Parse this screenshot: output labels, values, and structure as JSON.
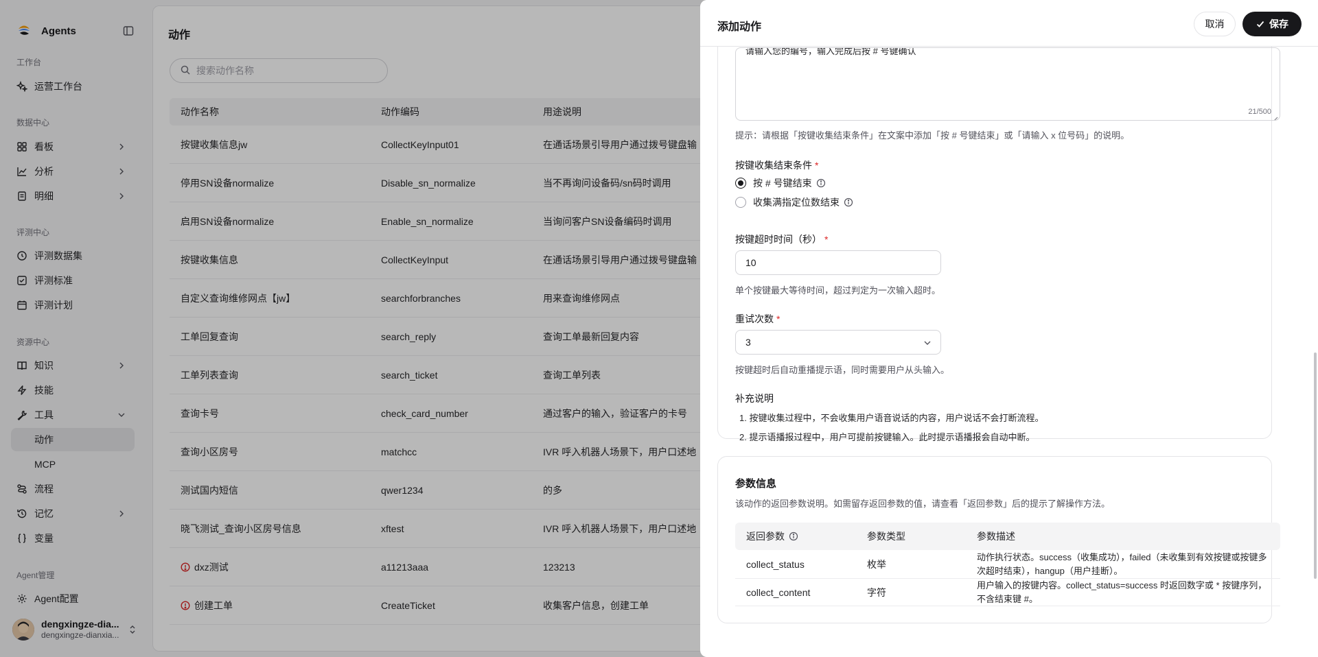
{
  "sidebar": {
    "brand": "Agents",
    "sections": {
      "workbench": "工作台",
      "data_center": "数据中心",
      "eval_center": "评测中心",
      "resource_center": "资源中心",
      "agent_mgmt": "Agent管理"
    },
    "items": {
      "ops_workbench": "运营工作台",
      "dashboard": "看板",
      "analysis": "分析",
      "details": "明细",
      "eval_dataset": "评测数据集",
      "eval_standard": "评测标准",
      "eval_plan": "评测计划",
      "knowledge": "知识",
      "skills": "技能",
      "tools": "工具",
      "actions": "动作",
      "mcp": "MCP",
      "flow": "流程",
      "memory": "记忆",
      "variables": "变量",
      "agent_config": "Agent配置"
    },
    "user": {
      "name": "dengxingze-dia...",
      "email": "dengxingze-dianxia..."
    }
  },
  "main": {
    "title": "动作",
    "search_placeholder": "搜索动作名称",
    "columns": [
      "动作名称",
      "动作编码",
      "用途说明"
    ],
    "rows": [
      {
        "name": "按键收集信息jw",
        "code": "CollectKeyInput01",
        "desc": "在通话场景引导用户通过拨号键盘输",
        "warn": false
      },
      {
        "name": "停用SN设备normalize",
        "code": "Disable_sn_normalize",
        "desc": "当不再询问设备码/sn码时调用",
        "warn": false
      },
      {
        "name": "启用SN设备normalize",
        "code": "Enable_sn_normalize",
        "desc": "当询问客户SN设备编码时调用",
        "warn": false
      },
      {
        "name": "按键收集信息",
        "code": "CollectKeyInput",
        "desc": "在通话场景引导用户通过拨号键盘输",
        "warn": false
      },
      {
        "name": "自定义查询维修网点【jw】",
        "code": "searchforbranches",
        "desc": "用来查询维修网点",
        "warn": false
      },
      {
        "name": "工单回复查询",
        "code": "search_reply",
        "desc": "查询工单最新回复内容",
        "warn": false
      },
      {
        "name": "工单列表查询",
        "code": "search_ticket",
        "desc": "查询工单列表",
        "warn": false
      },
      {
        "name": "查询卡号",
        "code": "check_card_number",
        "desc": "通过客户的输入，验证客户的卡号",
        "warn": false
      },
      {
        "name": "查询小区房号",
        "code": "matchcc",
        "desc": "IVR 呼入机器人场景下，用户口述地",
        "warn": false
      },
      {
        "name": "测试国内短信",
        "code": "qwer1234",
        "desc": "的多",
        "warn": false
      },
      {
        "name": "晓飞测试_查询小区房号信息",
        "code": "xftest",
        "desc": "IVR 呼入机器人场景下，用户口述地",
        "warn": false
      },
      {
        "name": "dxz测试",
        "code": "a11213aaa",
        "desc": "123213",
        "warn": true
      },
      {
        "name": "创建工单",
        "code": "CreateTicket",
        "desc": "收集客户信息，创建工单",
        "warn": true
      }
    ]
  },
  "drawer": {
    "title": "添加动作",
    "cancel": "取消",
    "save": "保存",
    "prompt_text": "请输入您的编号，输入完成后按 # 号键确认",
    "prompt_count": "21/500",
    "prompt_hint": "提示：请根据「按键收集结束条件」在文案中添加「按 # 号键结束」或「请输入 x 位号码」的说明。",
    "end_condition": {
      "label": "按键收集结束条件",
      "options": [
        "按 # 号键结束",
        "收集满指定位数结束"
      ],
      "selected": 0
    },
    "timeout": {
      "label": "按键超时时间（秒）",
      "value": "10",
      "hint": "单个按键最大等待时间，超过判定为一次输入超时。"
    },
    "retry": {
      "label": "重试次数",
      "value": "3",
      "hint": "按键超时后自动重播提示语，同时需要用户从头输入。"
    },
    "notes": {
      "title": "补充说明",
      "items": [
        "1. 按键收集过程中，不会收集用户语音说话的内容，用户说话不会打断流程。",
        "2. 提示语播报过程中，用户可提前按键输入。此时提示语播报会自动中断。"
      ]
    },
    "params": {
      "title": "参数信息",
      "desc": "该动作的返回参数说明。如需留存返回参数的值，请查看「返回参数」后的提示了解操作方法。",
      "columns": [
        "返回参数",
        "参数类型",
        "参数描述"
      ],
      "rows": [
        {
          "name": "collect_status",
          "type": "枚举",
          "desc": "动作执行状态。success（收集成功），failed（未收集到有效按键或按键多次超时结束），hangup（用户挂断）。"
        },
        {
          "name": "collect_content",
          "type": "字符",
          "desc": "用户输入的按键内容。collect_status=success 时返回数字或 * 按键序列，不含结束键 #。"
        }
      ]
    }
  },
  "colors": {
    "accent": "#18181b",
    "required": "#dc2626",
    "warning": "#dc2626",
    "overlay": "rgba(0,0,0,0.28)"
  }
}
